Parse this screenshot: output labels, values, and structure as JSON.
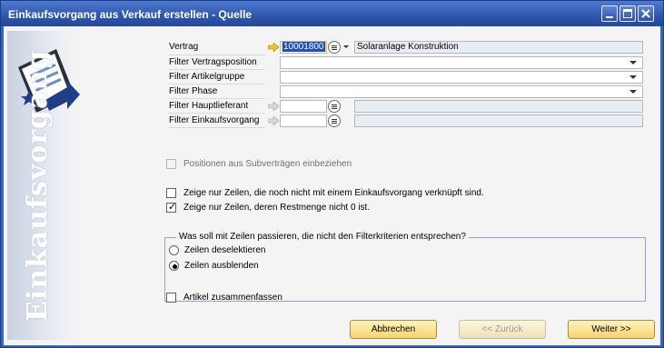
{
  "window": {
    "title": "Einkaufsvorgang aus Verkauf erstellen - Quelle"
  },
  "sidebar": {
    "watermark": "Einkaufsvorgang",
    "icon": "document-arrow-icon"
  },
  "filters": {
    "vertrag_label": "Vertrag",
    "vertrag_value": "10001800",
    "vertrag_desc": "Solaranlage Konstruktion",
    "vertragsposition_label": "Filter Vertragsposition",
    "artikelgruppe_label": "Filter Artikelgruppe",
    "phase_label": "Filter Phase",
    "hauptlieferant_label": "Filter Hauptlieferant",
    "einkaufsvorgang_label": "Filter Einkaufsvorgang"
  },
  "options": {
    "subvertraege": "Positionen aus Subverträgen einbeziehen",
    "nur_nicht_verknuepft": "Zeige nur Zeilen, die noch nicht mit einem Einkaufsvorgang verknüpft sind.",
    "restmenge": "Zeige nur Zeilen, deren Restmenge nicht 0 ist.",
    "zusammenfassen": "Artikel zusammenfassen"
  },
  "group": {
    "title": "Was soll mit Zeilen passieren, die nicht den Filterkriterien entsprechen?",
    "radio_deselect": "Zeilen deselektieren",
    "radio_hide": "Zeilen ausblenden"
  },
  "buttons": {
    "cancel": "Abbrechen",
    "back": "<< Zurück",
    "next": "Weiter >>"
  },
  "colors": {
    "title_bar": "#2d56aa",
    "button_fill": "#f6d46c",
    "link_arrow": "#f0c020"
  }
}
